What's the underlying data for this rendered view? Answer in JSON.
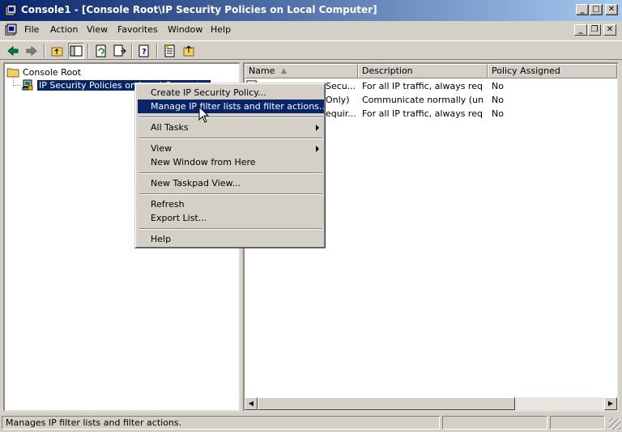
{
  "window": {
    "title": "Console1 - [Console Root\\IP Security Policies on Local Computer]"
  },
  "menubar": {
    "items": [
      {
        "label": "File"
      },
      {
        "label": "Action"
      },
      {
        "label": "View"
      },
      {
        "label": "Favorites"
      },
      {
        "label": "Window"
      },
      {
        "label": "Help"
      }
    ]
  },
  "toolbar": {
    "icons": [
      "back-icon",
      "forward-icon",
      "up-one-level-icon",
      "show-hide-console-tree-icon",
      "refresh-icon",
      "export-list-icon",
      "help-icon",
      "manage-filters-icon",
      "assign-icon"
    ]
  },
  "tree": {
    "root": "Console Root",
    "child": "IP Security Policies on Local Computer"
  },
  "list": {
    "columns": [
      "Name",
      "Description",
      "Policy Assigned"
    ],
    "rows": [
      {
        "name": "Secu...",
        "description": "For all IP traffic, always req...",
        "assigned": "No"
      },
      {
        "name": "Only)",
        "description": "Communicate normally (uns...",
        "assigned": "No"
      },
      {
        "name": "equir...",
        "description": "For all IP traffic, always req...",
        "assigned": "No"
      }
    ]
  },
  "context_menu": {
    "create_policy": "Create IP Security Policy...",
    "manage_filters": "Manage IP filter lists and filter actions...",
    "all_tasks": "All Tasks",
    "view": "View",
    "new_window": "New Window from Here",
    "new_taskpad": "New Taskpad View...",
    "refresh": "Refresh",
    "export_list": "Export List...",
    "help": "Help"
  },
  "statusbar": {
    "text": "Manages IP filter lists and filter actions."
  },
  "colors": {
    "title_gradient_start": "#0a246a",
    "title_gradient_end": "#a6caf0",
    "highlight": "#0a246a",
    "face": "#d4d0c8"
  }
}
